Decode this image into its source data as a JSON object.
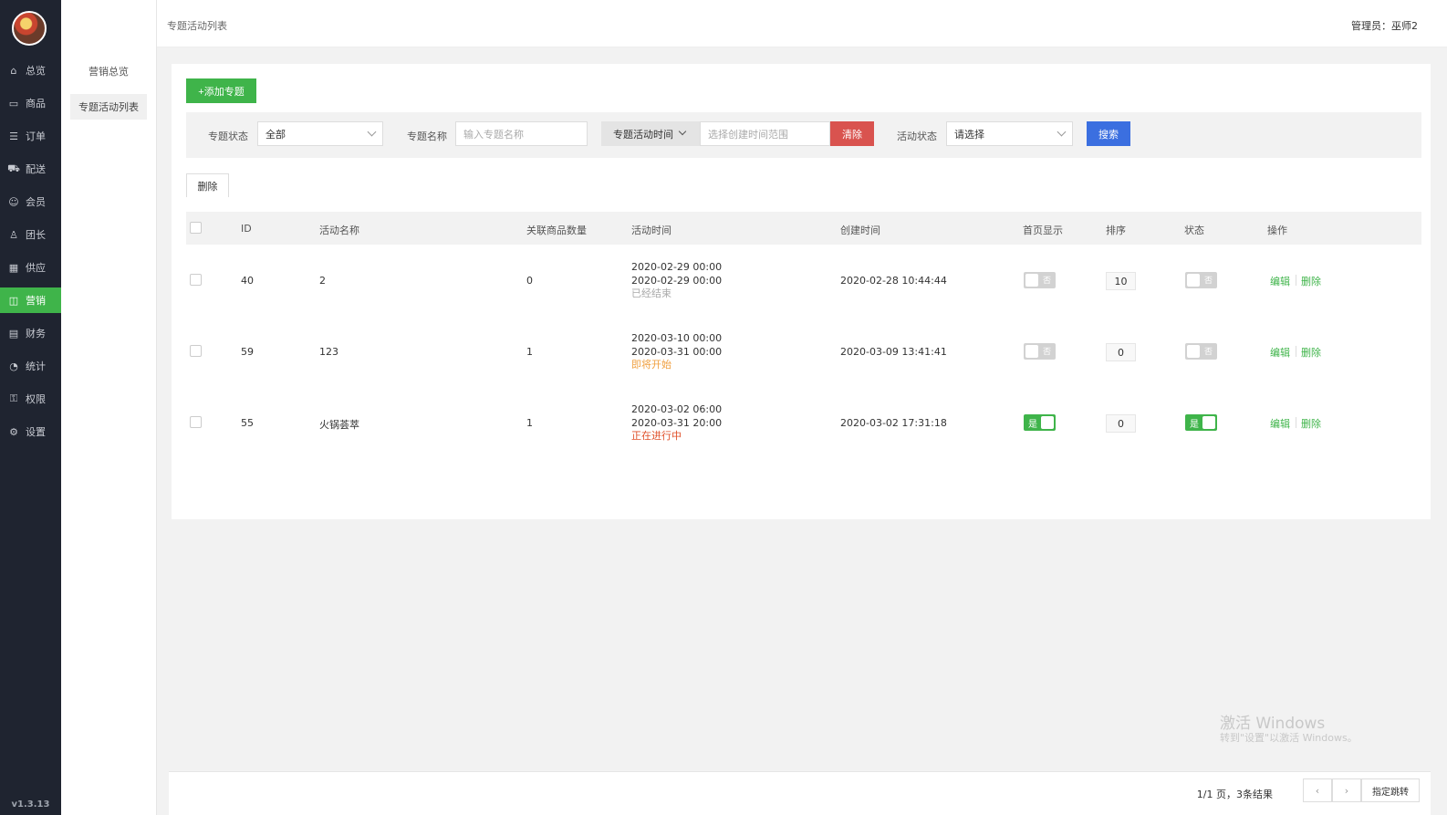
{
  "colors": {
    "accent": "#3fb44a",
    "danger": "#d9534f",
    "primary": "#3b6fe0",
    "sidebar_bg": "#1f2430",
    "status_ended": "#aaaaaa",
    "status_upcoming": "#f0a040",
    "status_ongoing": "#e0502a"
  },
  "sidebar": {
    "items": [
      {
        "icon": "home-icon",
        "label": "总览"
      },
      {
        "icon": "goods-icon",
        "label": "商品"
      },
      {
        "icon": "order-icon",
        "label": "订单"
      },
      {
        "icon": "delivery-icon",
        "label": "配送"
      },
      {
        "icon": "member-icon",
        "label": "会员"
      },
      {
        "icon": "leader-icon",
        "label": "团长"
      },
      {
        "icon": "supply-icon",
        "label": "供应"
      },
      {
        "icon": "gift-icon",
        "label": "营销"
      },
      {
        "icon": "finance-icon",
        "label": "财务"
      },
      {
        "icon": "stats-icon",
        "label": "统计"
      },
      {
        "icon": "permission-icon",
        "label": "权限"
      },
      {
        "icon": "settings-icon",
        "label": "设置"
      }
    ],
    "active_index": 7,
    "version": "v1.3.13"
  },
  "subnav": {
    "items": [
      {
        "label": "营销总览"
      },
      {
        "label": "专题活动列表"
      }
    ],
    "active_index": 1
  },
  "topbar": {
    "breadcrumb": "专题活动列表",
    "admin_label": "管理员：",
    "admin_name": "巫师2"
  },
  "toolbar": {
    "add_label": "+添加专题",
    "delete_label": "删除"
  },
  "filters": {
    "status_label": "专题状态",
    "status_value": "全部",
    "name_label": "专题名称",
    "name_placeholder": "输入专题名称",
    "date_type": "专题活动时间",
    "date_placeholder": "选择创建时间范围",
    "clear_label": "清除",
    "activity_status_label": "活动状态",
    "activity_status_value": "请选择",
    "search_label": "搜索"
  },
  "table": {
    "headers": [
      "ID",
      "活动名称",
      "关联商品数量",
      "活动时间",
      "创建时间",
      "首页显示",
      "排序",
      "状态",
      "操作"
    ],
    "rows": [
      {
        "id": "40",
        "name": "2",
        "goods_count": "0",
        "start": "2020-02-29 00:00",
        "end": "2020-02-29 00:00",
        "status": "已经结束",
        "status_type": "ended",
        "created": "2020-02-28 10:44:44",
        "home": false,
        "sort": "10",
        "enabled": false
      },
      {
        "id": "59",
        "name": "123",
        "goods_count": "1",
        "start": "2020-03-10 00:00",
        "end": "2020-03-31 00:00",
        "status": "即将开始",
        "status_type": "upcoming",
        "created": "2020-03-09 13:41:41",
        "home": false,
        "sort": "0",
        "enabled": false
      },
      {
        "id": "55",
        "name": "火锅荟萃",
        "goods_count": "1",
        "start": "2020-03-02 06:00",
        "end": "2020-03-31 20:00",
        "status": "正在进行中",
        "status_type": "ongoing",
        "created": "2020-03-02 17:31:18",
        "home": true,
        "sort": "0",
        "enabled": true
      }
    ],
    "switch_on_text": "是",
    "switch_off_text": "否",
    "edit_label": "编辑",
    "delete_label": "删除"
  },
  "watermark": {
    "line1": "激活 Windows",
    "line2": "转到\"设置\"以激活 Windows。"
  },
  "pager": {
    "info": "1/1 页，3条结果",
    "prev": "‹",
    "next": "›",
    "jump_label": "指定跳转"
  }
}
